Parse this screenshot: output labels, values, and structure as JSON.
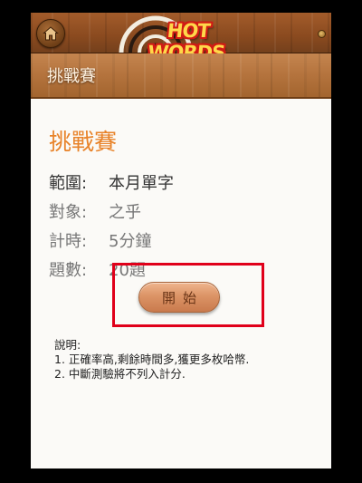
{
  "header": {
    "logo_text": "HOT WORDS",
    "home_icon": "home-icon"
  },
  "nav": {
    "title": "挑戰賽"
  },
  "challenge": {
    "heading": "挑戰賽",
    "fields": [
      {
        "label": "範圍:",
        "value": "本月單字"
      },
      {
        "label": "對象:",
        "value": "之乎"
      },
      {
        "label": "計時:",
        "value": "5分鐘"
      },
      {
        "label": "題數:",
        "value": "20題"
      }
    ],
    "start_label": "開始"
  },
  "notes": {
    "title": "說明:",
    "items": [
      "1. 正確率高,剩餘時間多,獲更多枚哈幣.",
      "2. 中斷測驗將不列入計分."
    ]
  },
  "colors": {
    "accent_orange": "#e8832a",
    "highlight_red": "#e0001a",
    "wood": "#b4733d"
  }
}
